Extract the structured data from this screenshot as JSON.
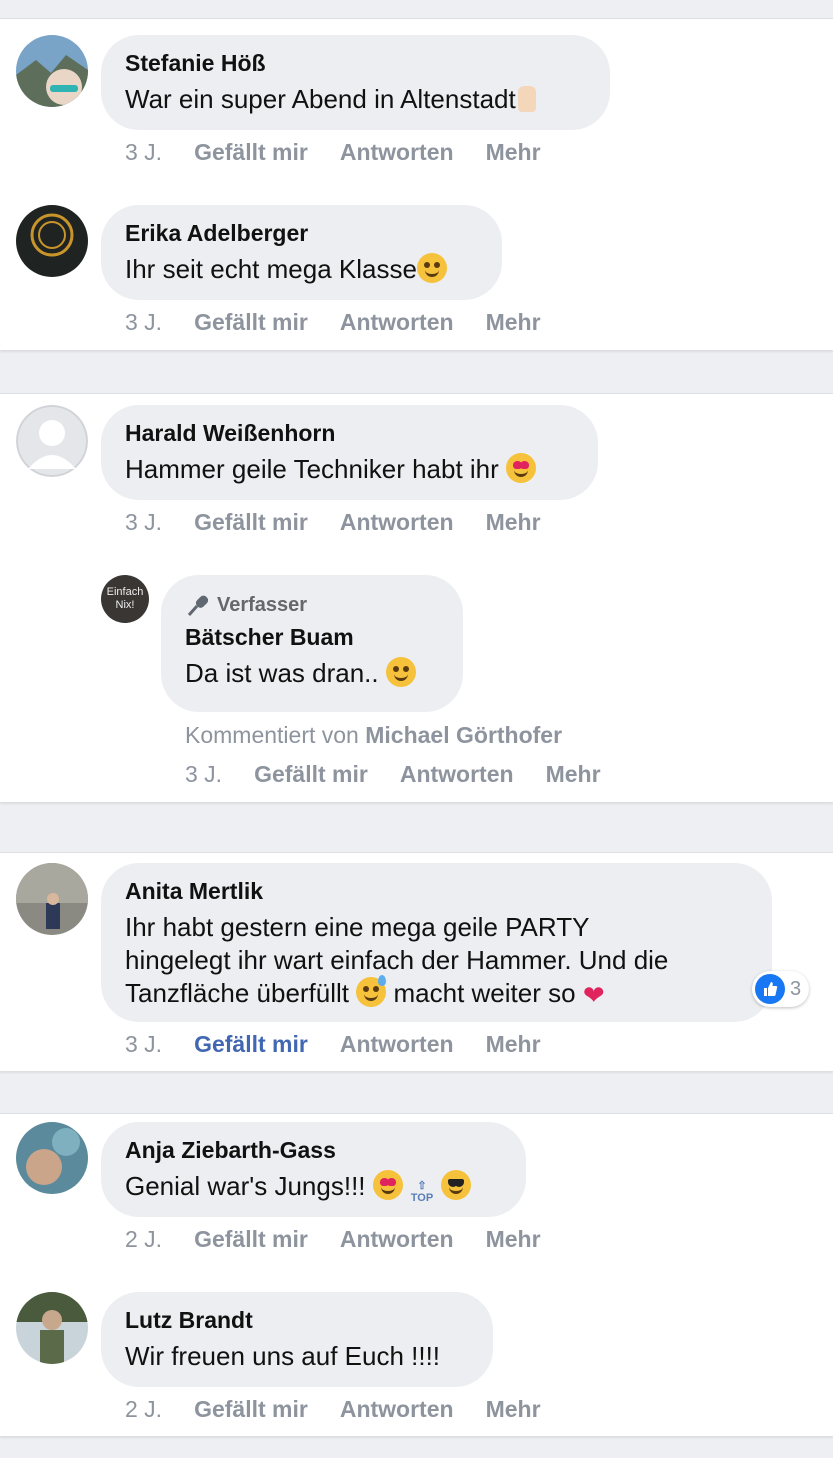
{
  "comments": [
    {
      "author": "Stefanie Höß",
      "text": "War ein super Abend in Altenstadt",
      "time": "3 J.",
      "like": "Gefällt mir",
      "reply": "Antworten",
      "more": "Mehr"
    },
    {
      "author": "Erika Adelberger",
      "text": "Ihr seit echt mega Klasse",
      "time": "3 J.",
      "like": "Gefällt mir",
      "reply": "Antworten",
      "more": "Mehr"
    },
    {
      "author": "Harald Weißenhorn",
      "text": "Hammer geile Techniker habt ihr",
      "time": "3 J.",
      "like": "Gefällt mir",
      "reply": "Antworten",
      "more": "Mehr"
    },
    {
      "author": "Anita Mertlik",
      "text_line1": "Ihr habt gestern eine mega geile PARTY",
      "text_line2": "hingelegt ihr wart einfach der Hammer. Und die",
      "text_line3a": "Tanzfläche überfüllt",
      "text_line3b": "macht weiter so",
      "time": "3 J.",
      "like": "Gefällt mir",
      "reply": "Antworten",
      "more": "Mehr",
      "reaction_count": "3"
    },
    {
      "author": "Anja Ziebarth-Gass",
      "text": "Genial war's Jungs!!!",
      "time": "2 J.",
      "like": "Gefällt mir",
      "reply": "Antworten",
      "more": "Mehr",
      "top_label": "TOP"
    },
    {
      "author": "Lutz Brandt",
      "text": "Wir freuen uns auf Euch !!!!",
      "time": "2 J.",
      "like": "Gefällt mir",
      "reply": "Antworten",
      "more": "Mehr"
    }
  ],
  "reply": {
    "badge": "Verfasser",
    "author": "Bätscher Buam",
    "text": "Da ist was dran..",
    "commented_prefix": "Kommentiert von",
    "commented_by": "Michael Görthofer",
    "time": "3 J.",
    "like": "Gefällt mir",
    "reply": "Antworten",
    "more": "Mehr",
    "avatar_text": "Einfach Nix!"
  },
  "colors": {
    "link": "#4267b2",
    "meta": "#8d949e",
    "bubble": "#eceef1",
    "background": "#edeff3"
  }
}
